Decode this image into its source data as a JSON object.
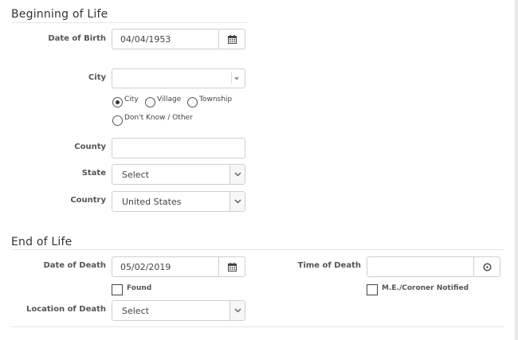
{
  "beginning": {
    "title": "Beginning of Life",
    "dob_label": "Date of Birth",
    "dob_value": "04/04/1953",
    "city_label": "City",
    "city_value": "",
    "radio_options": [
      "City",
      "Village",
      "Township",
      "Don't Know / Other"
    ],
    "radio_selected": "City",
    "county_label": "County",
    "county_value": "",
    "state_label": "State",
    "state_value": "Select",
    "country_label": "Country",
    "country_value": "United States"
  },
  "end": {
    "title": "End of Life",
    "dod_label": "Date of Death",
    "dod_value": "05/02/2019",
    "found_label": "Found",
    "found_checked": false,
    "tod_label": "Time of Death",
    "tod_value": "",
    "me_label": "M.E./Coroner Notified",
    "me_checked": false,
    "location_label": "Location of Death",
    "location_value": "Select"
  },
  "icons": {
    "calendar": "calendar-icon",
    "clock": "clock-icon",
    "dropdown": "chevron-down-icon"
  }
}
